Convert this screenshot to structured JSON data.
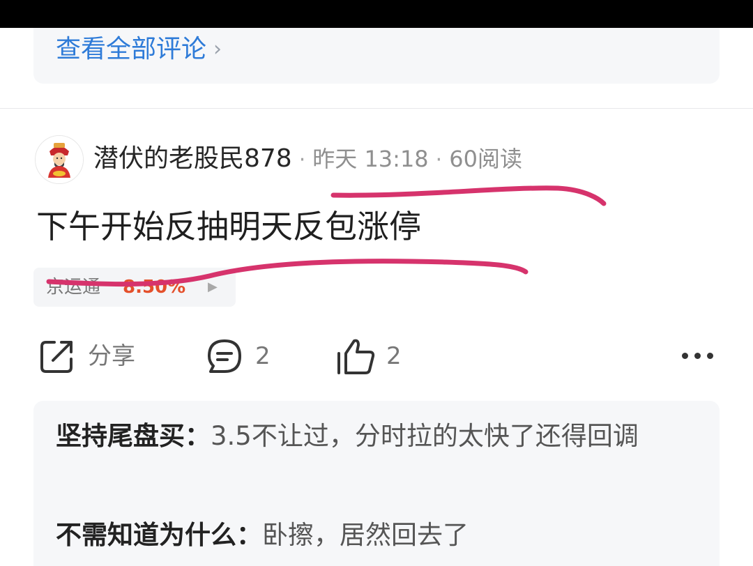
{
  "top_card": {
    "view_all_comments": "查看全部评论",
    "chevron_icon": "chevron-right-icon"
  },
  "post": {
    "author": "潜伏的老股民878",
    "separator": "·",
    "time": "昨天 13:18",
    "reads": "60阅读",
    "title": "下午开始反抽明天反包涨停",
    "stock": {
      "name": "京运通",
      "change": "8.50%",
      "change_color": "#e4502b"
    }
  },
  "actions": {
    "share_label": "分享",
    "comment_count": "2",
    "like_count": "2"
  },
  "comments": [
    {
      "user": "坚持尾盘买：",
      "text": "3.5不让过，分时拉的太快了还得回调"
    },
    {
      "user": "不需知道为什么：",
      "text": "卧擦，居然回去了"
    }
  ],
  "colors": {
    "link": "#2e7bd8",
    "annotation_ink": "#d6336c",
    "rise_red": "#e4502b"
  }
}
